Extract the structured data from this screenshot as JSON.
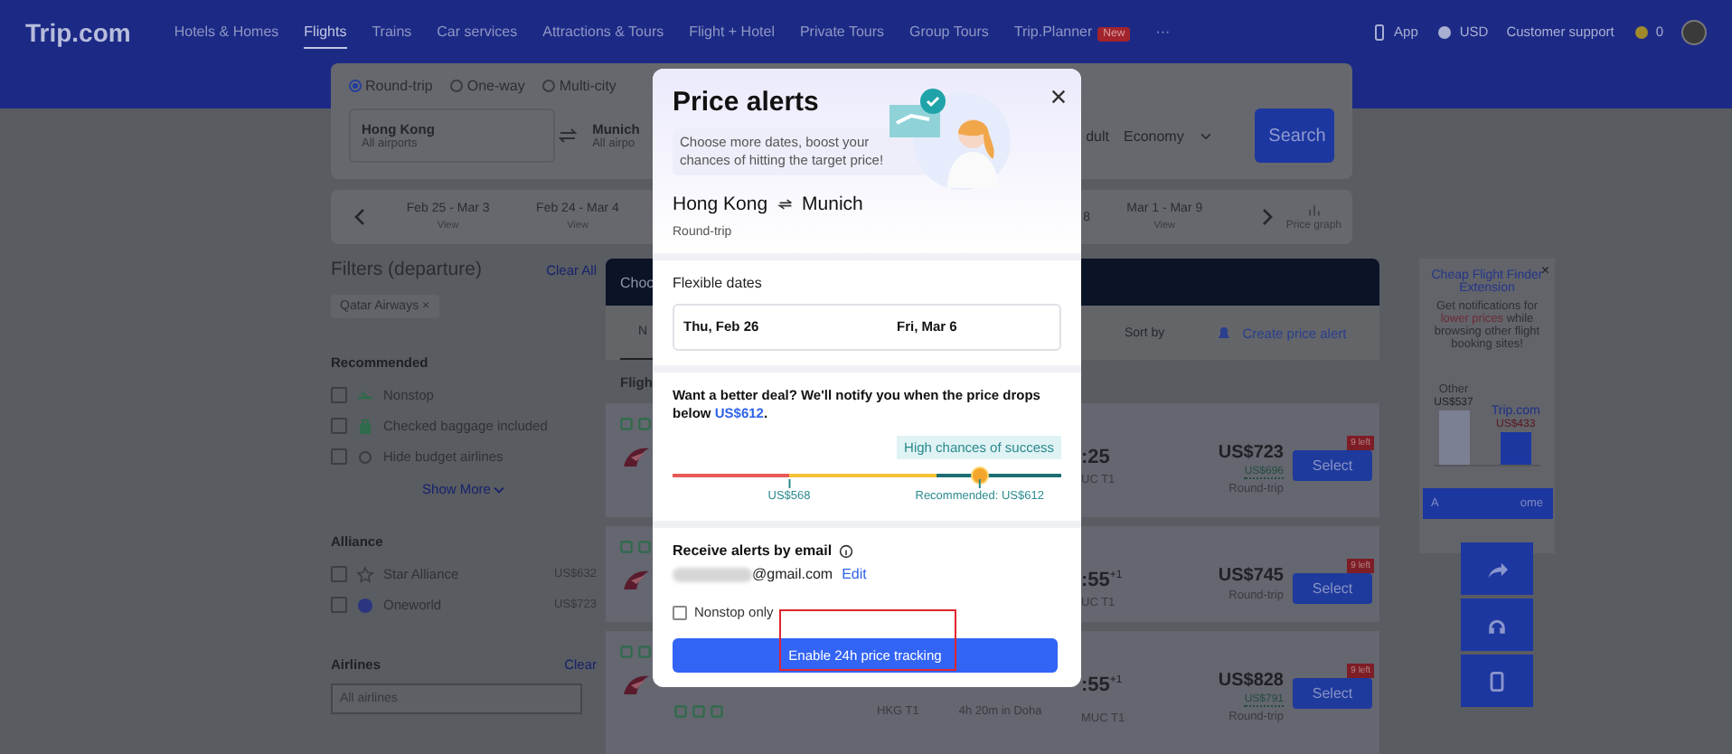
{
  "nav": {
    "logo": "Trip.com",
    "items": [
      {
        "label": "Hotels & Homes",
        "selected": false
      },
      {
        "label": "Flights",
        "selected": true
      },
      {
        "label": "Trains",
        "selected": false
      },
      {
        "label": "Car services",
        "selected": false
      },
      {
        "label": "Attractions & Tours",
        "selected": false
      },
      {
        "label": "Flight + Hotel",
        "selected": false
      },
      {
        "label": "Private Tours",
        "selected": false
      },
      {
        "label": "Group Tours",
        "selected": false
      },
      {
        "label": "Trip.Planner",
        "selected": false,
        "badge": "New"
      }
    ],
    "more": "···",
    "right": [
      {
        "kind": "app",
        "label": "App"
      },
      {
        "kind": "currency",
        "label": "USD"
      },
      {
        "kind": "support",
        "label": "Customer support"
      },
      {
        "kind": "coins",
        "label": "0"
      }
    ]
  },
  "search": {
    "trip_types": [
      {
        "label": "Round-trip",
        "selected": true
      },
      {
        "label": "One-way",
        "selected": false
      },
      {
        "label": "Multi-city",
        "selected": false
      }
    ],
    "from": {
      "city": "Hong Kong",
      "airports": "All airports"
    },
    "to": {
      "city": "Munich",
      "airports": "All airpo"
    },
    "passengers": "dult",
    "cabin": "Economy",
    "button": "Search"
  },
  "date_strip": {
    "left": [
      {
        "dates": "Feb 25 - Mar 3",
        "action": "View"
      },
      {
        "dates": "Feb 24 - Mar 4",
        "action": "View"
      }
    ],
    "right": [
      {
        "dates": "8"
      },
      {
        "dates": "Mar 1 - Mar 9",
        "action": "View"
      }
    ],
    "price_graph": "Price graph"
  },
  "filters": {
    "title": "Filters (departure)",
    "clear_all": "Clear All",
    "chip": "Qatar Airways",
    "chip_close": "×",
    "recommended": {
      "title": "Recommended",
      "options": [
        {
          "kind": "nonstop",
          "label": "Nonstop",
          "checked": false
        },
        {
          "kind": "baggage",
          "label": "Checked baggage included",
          "checked": false
        },
        {
          "kind": "budget",
          "label": "Hide budget airlines",
          "checked": false
        }
      ],
      "show_more": "Show More"
    },
    "alliance": {
      "title": "Alliance",
      "options": [
        {
          "kind": "star",
          "label": "Star Alliance",
          "price": "US$632",
          "checked": false
        },
        {
          "kind": "oneworld",
          "label": "Oneworld",
          "price": "US$723",
          "checked": false
        }
      ]
    },
    "airlines": {
      "title": "Airlines",
      "clear": "Clear",
      "placeholder": "All airlines"
    }
  },
  "results": {
    "header": "Choo",
    "tab": "N",
    "sort_label": "Sort by",
    "create_alert": "Create price alert",
    "section": "Fligh",
    "rows": [
      {
        "time": ":25",
        "plus": "",
        "terminal": "UC T1",
        "price": "US$723",
        "member_price": "US$696",
        "trip": "Round-trip",
        "select": "Select",
        "left": "9 left"
      },
      {
        "time": ":55",
        "plus": "+1",
        "terminal": "UC T1",
        "price": "US$745",
        "trip": "Round-trip",
        "select": "Select",
        "left": "9 left"
      },
      {
        "time": ":55",
        "plus": "+1",
        "terminal": "MUC T1",
        "depart_terminal": "HKG T1",
        "stop_info": "4h 20m in Doha",
        "price": "US$828",
        "member_price": "US$791",
        "trip": "Round-trip",
        "select": "Select",
        "left": "9 left"
      }
    ]
  },
  "ad": {
    "close": "×",
    "title": "Cheap Flight Finder Extension",
    "text": "Get notifications for **lower prices** while browsing other flight booking sites!",
    "other_label": "Other",
    "other_price": "US$537",
    "trip_label": "Trip.com",
    "trip_price": "US$433",
    "button_start": "A",
    "button_end": "ome"
  },
  "modal": {
    "title": "Price alerts",
    "subtitle": "Choose more dates, boost your chances of hitting the target price!",
    "route_from": "Hong Kong",
    "route_to": "Munich",
    "trip": "Round-trip",
    "flexible_title": "Flexible dates",
    "depart_date": "Thu, Feb 26",
    "return_date": "Fri, Mar 6",
    "deal_text": "Want a better deal? We'll notify you when the price drops below",
    "deal_price": "US$612",
    "deal_end": ".",
    "badge": "High chances of success",
    "slider": {
      "level": 0.79,
      "low_label": "US$568",
      "recommended_label": "Recommended: US$612"
    },
    "email_title": "Receive alerts by email",
    "email": "@gmail.com",
    "edit": "Edit",
    "nonstop": {
      "label": "Nonstop only",
      "checked": false
    },
    "button": "Enable 24h price tracking"
  }
}
